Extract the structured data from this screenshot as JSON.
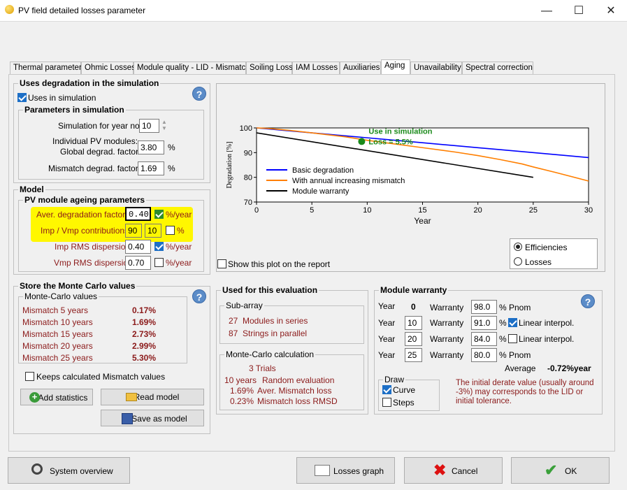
{
  "window": {
    "title": "PV field detailed losses parameter",
    "minimize": "—",
    "maximize": "☐",
    "close": "✕"
  },
  "tabs": [
    "Thermal parameter",
    "Ohmic Losses",
    "Module quality - LID - Mismatch",
    "Soiling Loss",
    "IAM Losses",
    "Auxiliaries",
    "Aging",
    "Unavailability",
    "Spectral correction"
  ],
  "degradation": {
    "title": "Uses degradation in the simulation",
    "uses_label": "Uses in simulation",
    "params_title": "Parameters in simulation",
    "year_label": "Simulation for year no",
    "year_value": "10",
    "pv_label1": "Individual PV modules:",
    "pv_label2": "Global degrad. factor",
    "pv_value": "3.80",
    "pct": "%",
    "mismatch_label": "Mismatch degrad. factor",
    "mismatch_value": "1.69"
  },
  "model": {
    "title": "Model",
    "sub_title": "PV module ageing parameters",
    "aver_label": "Aver. degradation factor",
    "aver_value": "0.40",
    "aver_unit": "%/year",
    "imp_vmp_label": "Imp / Vmp contributions",
    "imp_value": "90",
    "vmp_value": "10",
    "imp_vmp_unit": "%",
    "imp_rms_label": "Imp RMS dispersion",
    "imp_rms_value": "0.40",
    "imp_rms_unit": "%/year",
    "vmp_rms_label": "Vmp RMS dispersion",
    "vmp_rms_value": "0.70",
    "vmp_rms_unit": "%/year"
  },
  "chart_data": {
    "type": "line",
    "xlabel": "Year",
    "ylabel": "Degradation [%]",
    "xlim": [
      0,
      30
    ],
    "ylim": [
      70,
      100
    ],
    "xticks": [
      0,
      5,
      10,
      15,
      20,
      25,
      30
    ],
    "yticks": [
      70,
      80,
      90,
      100
    ],
    "series": [
      {
        "name": "Basic degradation",
        "color": "#0000ff",
        "x": [
          0,
          2,
          5,
          8,
          10,
          12,
          15,
          18,
          20,
          22,
          25,
          28,
          30
        ],
        "y": [
          100,
          99.2,
          98,
          96.8,
          96,
          95.2,
          94,
          92.8,
          92,
          91.2,
          90,
          88.8,
          88
        ]
      },
      {
        "name": "With annual increasing mismatch",
        "color": "#ff7f00",
        "x": [
          0,
          1,
          3,
          5,
          8,
          10,
          12,
          15,
          18,
          20,
          22,
          24,
          25,
          27,
          30
        ],
        "y": [
          100,
          99.8,
          99,
          98,
          96.4,
          95,
          93.8,
          92,
          90.2,
          88.8,
          87.2,
          85.4,
          84.2,
          82,
          78.5
        ]
      },
      {
        "name": "Module warranty",
        "color": "#000000",
        "x": [
          0,
          25
        ],
        "y": [
          98,
          80
        ]
      }
    ],
    "annotation": {
      "text1": "Use in simulation",
      "text2": "Loss = 5.5%",
      "x": 9.5,
      "y": 94.5
    },
    "legend": "left"
  },
  "plot_options": {
    "show_on_report": "Show this plot on the report",
    "efficiencies": "Efficiencies",
    "losses": "Losses"
  },
  "monte_carlo": {
    "title": "Store the Monte Carlo values",
    "values_title": "Monte-Carlo values",
    "rows": [
      {
        "label": "Mismatch  5 years",
        "value": "0.17%"
      },
      {
        "label": "Mismatch 10 years",
        "value": "1.69%"
      },
      {
        "label": "Mismatch 15 years",
        "value": "2.73%"
      },
      {
        "label": "Mismatch 20 years",
        "value": "2.99%"
      },
      {
        "label": "Mismatch 25 years",
        "value": "5.30%"
      }
    ],
    "keep_label": "Keeps calculated Mismatch values",
    "add_stats": "Add statistics",
    "read_model": "Read model",
    "save_model": "Save as model"
  },
  "evaluation": {
    "title": "Used for this evaluation",
    "subarray_title": "Sub-array",
    "modules_num": "27",
    "modules_label": "Modules in series",
    "strings_num": "87",
    "strings_label": "Strings in parallel",
    "mc_title": "Monte-Carlo calculation",
    "trials": "3 Trials",
    "years": "10 years",
    "years_label": "Random evaluation",
    "aver_val": "1.69%",
    "aver_label": "Aver. Mismatch loss",
    "rmsd_val": "0.23%",
    "rmsd_label": "Mismatch loss RMSD"
  },
  "warranty": {
    "title": "Module warranty",
    "year_label": "Year",
    "warranty_label": "Warranty",
    "rows": [
      {
        "year": "0",
        "value": "98.0",
        "unit": "% Pnom",
        "interp": ""
      },
      {
        "year": "10",
        "value": "91.0",
        "unit": "%",
        "interp": "Linear interpol."
      },
      {
        "year": "20",
        "value": "84.0",
        "unit": "%",
        "interp": "Linear interpol."
      },
      {
        "year": "25",
        "value": "80.0",
        "unit": "% Pnom",
        "interp": ""
      }
    ],
    "average_label": "Average",
    "average_value": "-0.72%year",
    "draw_title": "Draw",
    "curve": "Curve",
    "steps": "Steps",
    "note": "The initial derate value (usually around -3%) may corresponds to the LID or initial tolerance."
  },
  "footer": {
    "system_overview": "System overview",
    "losses_graph": "Losses graph",
    "cancel": "Cancel",
    "ok": "OK"
  }
}
